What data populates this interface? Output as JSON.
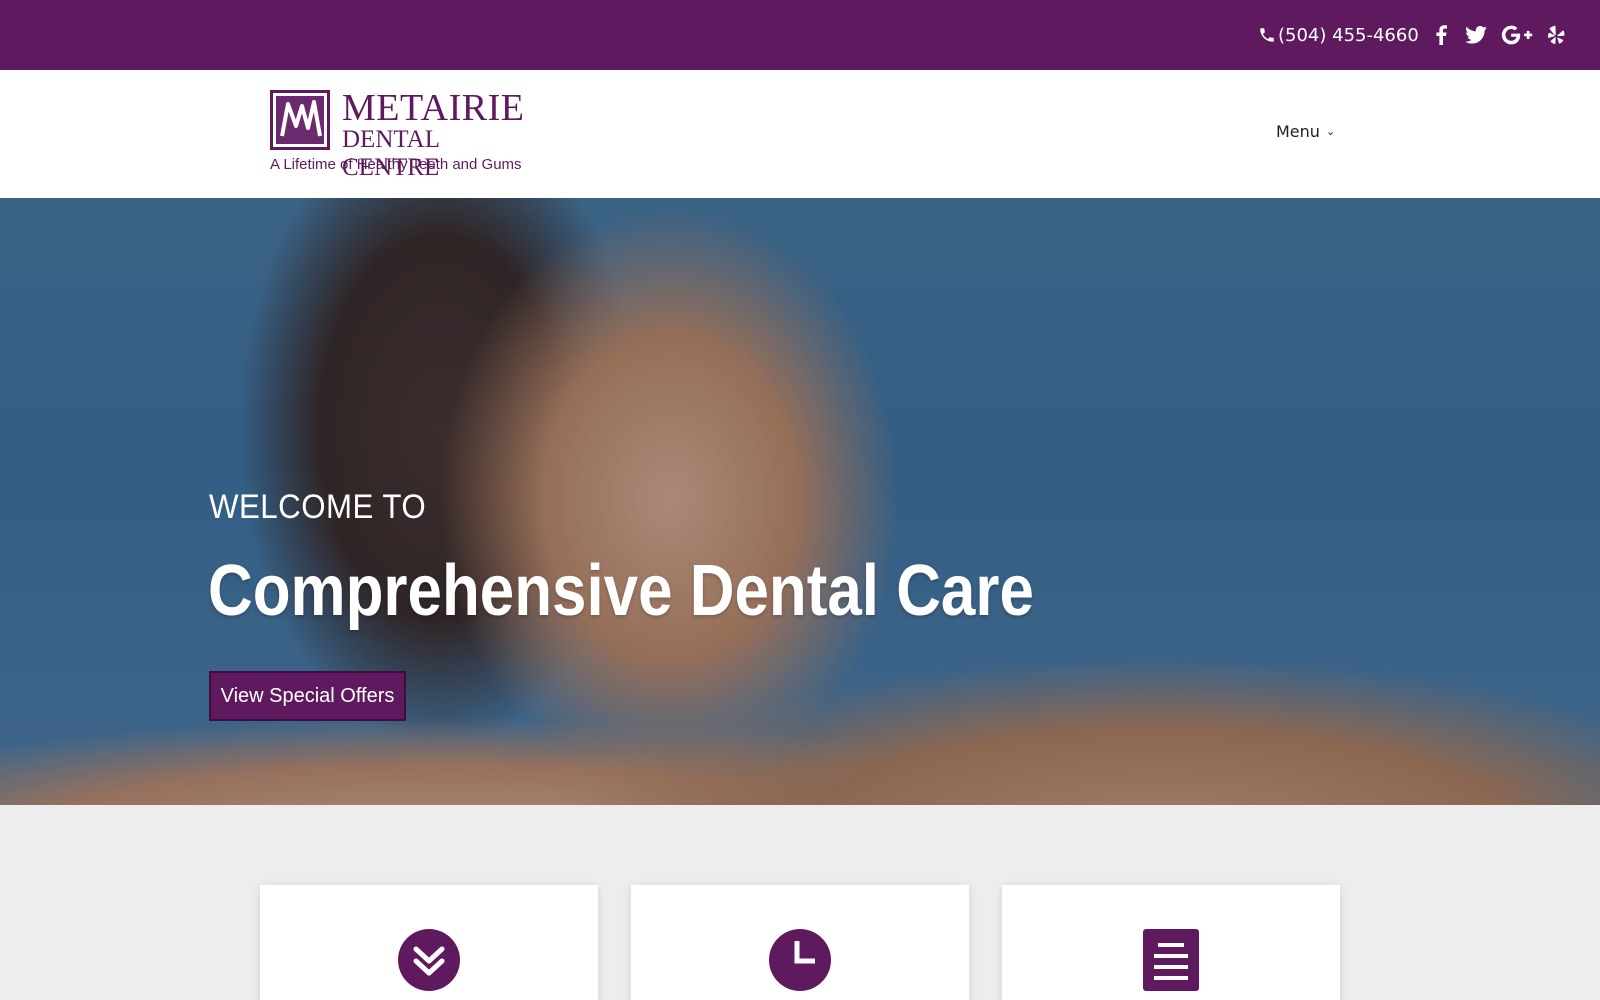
{
  "topbar": {
    "phone": "(504) 455-4660",
    "social": [
      {
        "icon": "facebook-icon"
      },
      {
        "icon": "twitter-icon"
      },
      {
        "icon": "google-plus-icon"
      },
      {
        "icon": "yelp-icon"
      }
    ]
  },
  "header": {
    "logo": {
      "name_line1": "METAIRIE",
      "name_line2": "DENTAL CENTRE",
      "tagline": "A Lifetime of Healthy Teeth and Gums"
    },
    "menu_label": "Menu"
  },
  "hero": {
    "subtitle": "WELCOME TO",
    "title": "Comprehensive Dental Care",
    "cta_label": "View Special Offers"
  },
  "cards": [
    {
      "icon": "double-chevron-down-icon"
    },
    {
      "icon": "clock-icon"
    },
    {
      "icon": "document-icon"
    }
  ],
  "colors": {
    "brand": "#5f1a5f",
    "background": "#ededed"
  }
}
